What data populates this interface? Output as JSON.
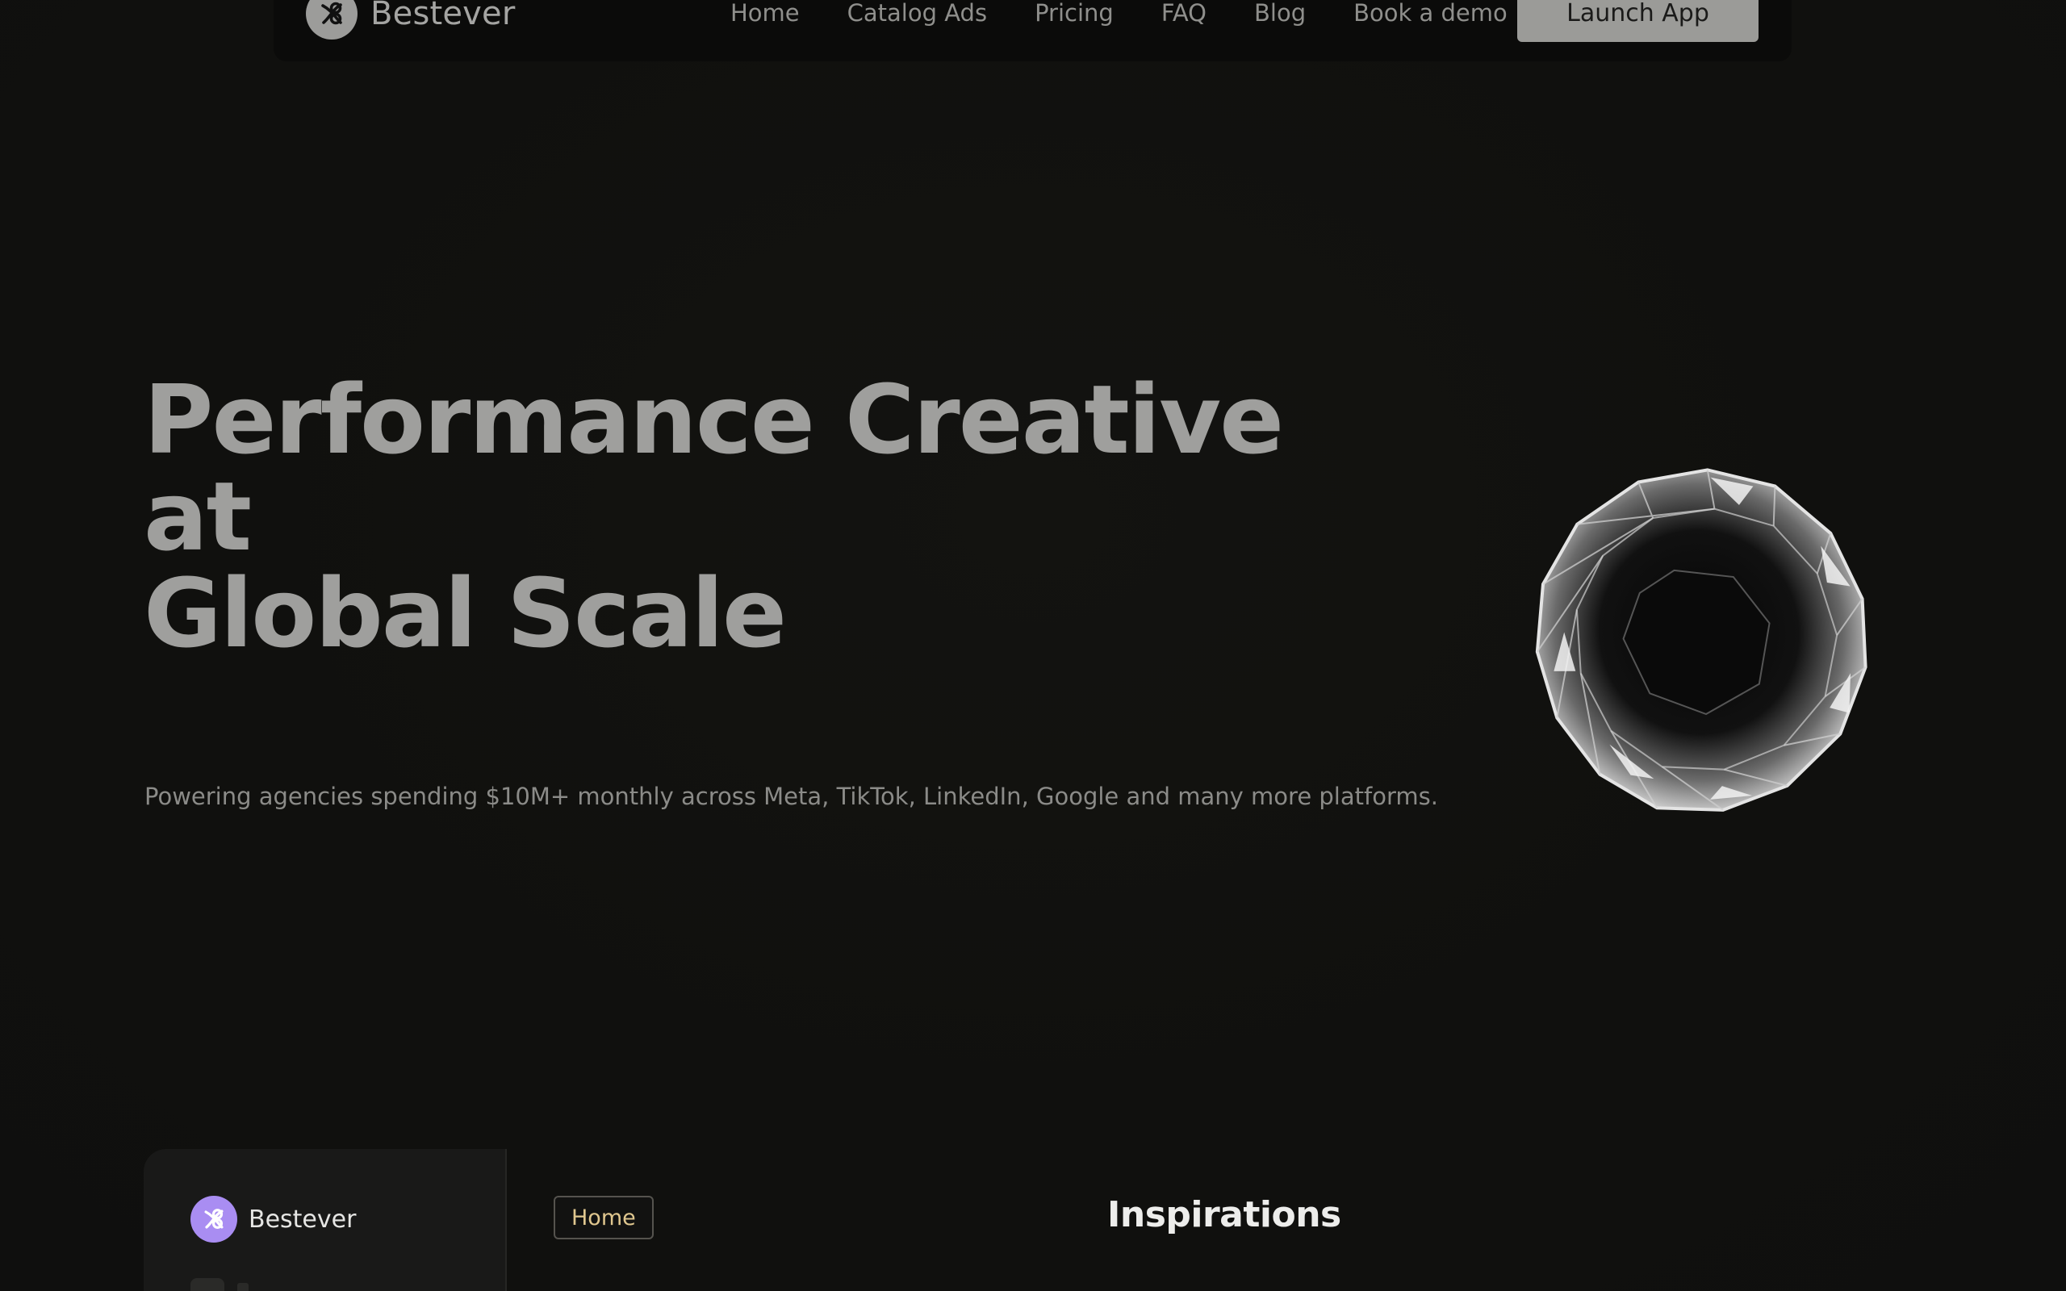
{
  "nav": {
    "brand_name": "Bestever",
    "links": [
      "Home",
      "Catalog Ads",
      "Pricing",
      "FAQ",
      "Blog",
      "Book a demo"
    ],
    "cta_label": "Launch App"
  },
  "hero": {
    "title_line1": "Performance Creative at",
    "title_line2": "Global Scale",
    "subtitle": "Powering agencies spending $10M+ monthly across Meta, TikTok, LinkedIn, Google and many more platforms."
  },
  "preview": {
    "brand_name": "Bestever",
    "home_chip": "Home",
    "section_title": "Inspirations"
  },
  "colors": {
    "background": "#10100e",
    "nav_bg": "#0b0b0a",
    "text_muted": "#9f9f9d",
    "cta_bg": "#9b9b98",
    "accent_purple": "#a98df2",
    "accent_gold": "#e0c78f"
  },
  "icons": {
    "brand": "bestever-logo-icon",
    "hero_visual": "diamond-icon"
  }
}
